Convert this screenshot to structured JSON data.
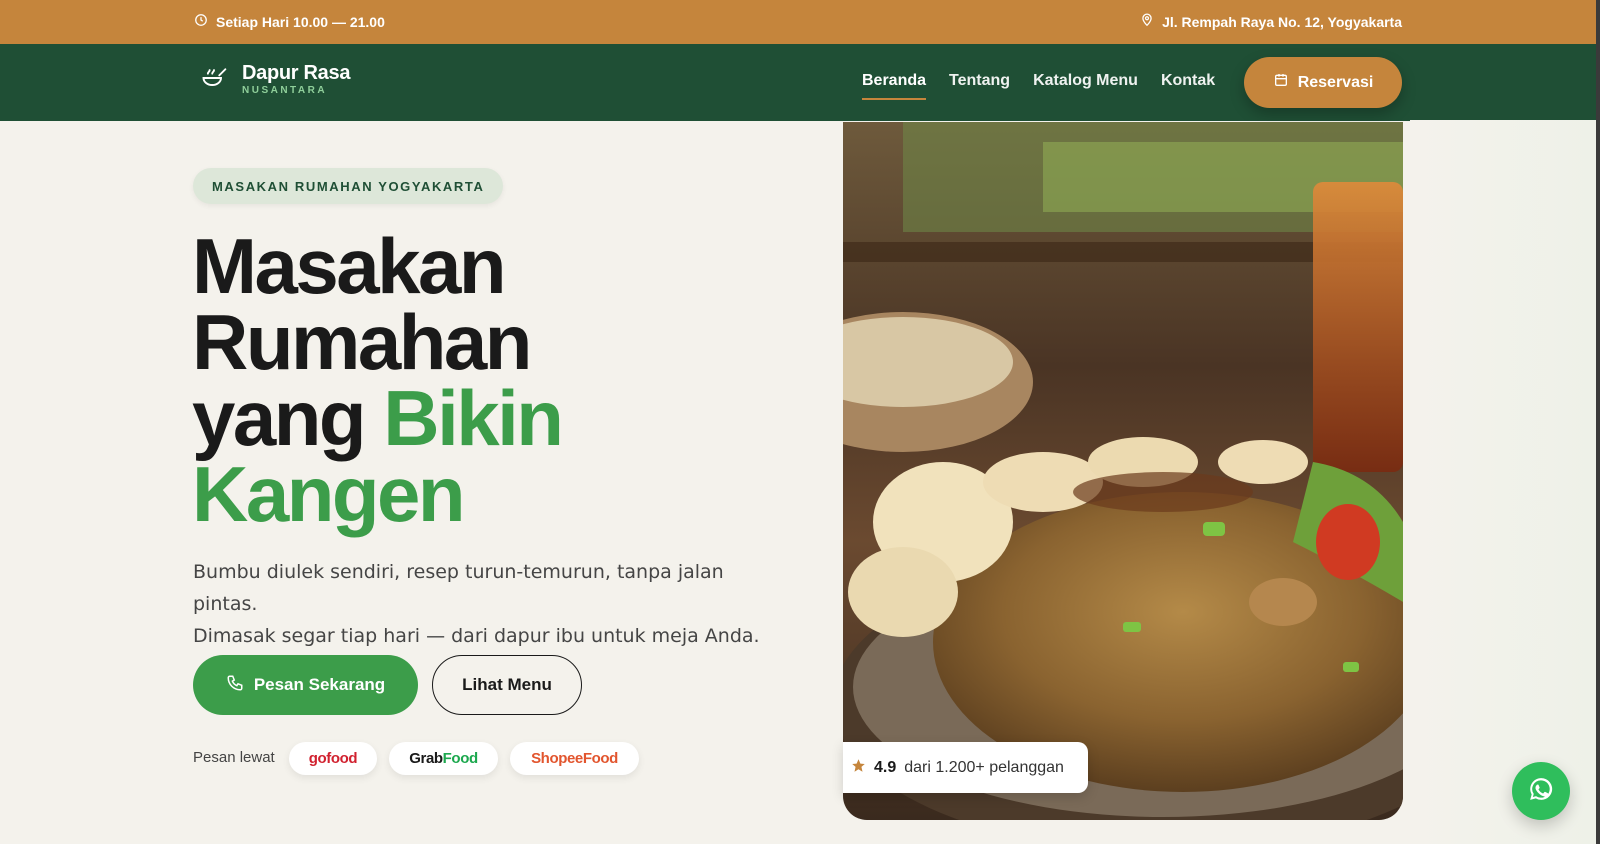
{
  "topbar": {
    "hours": "Setiap Hari 10.00 — 21.00",
    "address": "Jl. Rempah Raya No. 12, Yogyakarta",
    "hours_icon": "clock-icon",
    "address_icon": "map-pin-icon"
  },
  "nav": {
    "brand_name": "Dapur Rasa",
    "brand_sub": "NUSANTARA",
    "logo_icon": "cooking-bowl-icon",
    "links": [
      {
        "label": "Beranda",
        "active": true
      },
      {
        "label": "Tentang"
      },
      {
        "label": "Katalog Menu"
      },
      {
        "label": "Kontak"
      }
    ],
    "reserve_label": "Reservasi",
    "reserve_icon": "calendar-icon"
  },
  "hero": {
    "tag": "MASAKAN RUMAHAN YOGYAKARTA",
    "headline_line1": "Masakan",
    "headline_line2": "Rumahan",
    "headline_line3a": "yang",
    "headline_line3b": "Bikin",
    "headline_line4": "Kangen",
    "lead_line1": "Bumbu diulek sendiri, resep turun-temurun, tanpa jalan pintas.",
    "lead_line2": "Dimasak segar tiap hari — dari dapur ibu untuk meja Anda.",
    "order_label": "Pesan Sekarang",
    "order_icon": "phone-icon",
    "menu_label": "Lihat Menu",
    "via_label": "Pesan lewat",
    "platforms": {
      "gofood": "gofood",
      "grab_a": "Grab",
      "grab_b": "Food",
      "shopee": "ShopeeFood"
    }
  },
  "rating": {
    "score": "4.9",
    "text": "dari 1.200+ pelanggan",
    "icon": "star-icon"
  },
  "colors": {
    "topbar": "#c5853c",
    "nav": "#1f4f35",
    "accent_green": "#3c9d4a",
    "whatsapp": "#2fbe5c"
  },
  "floating": {
    "whatsapp_icon": "whatsapp-icon"
  }
}
